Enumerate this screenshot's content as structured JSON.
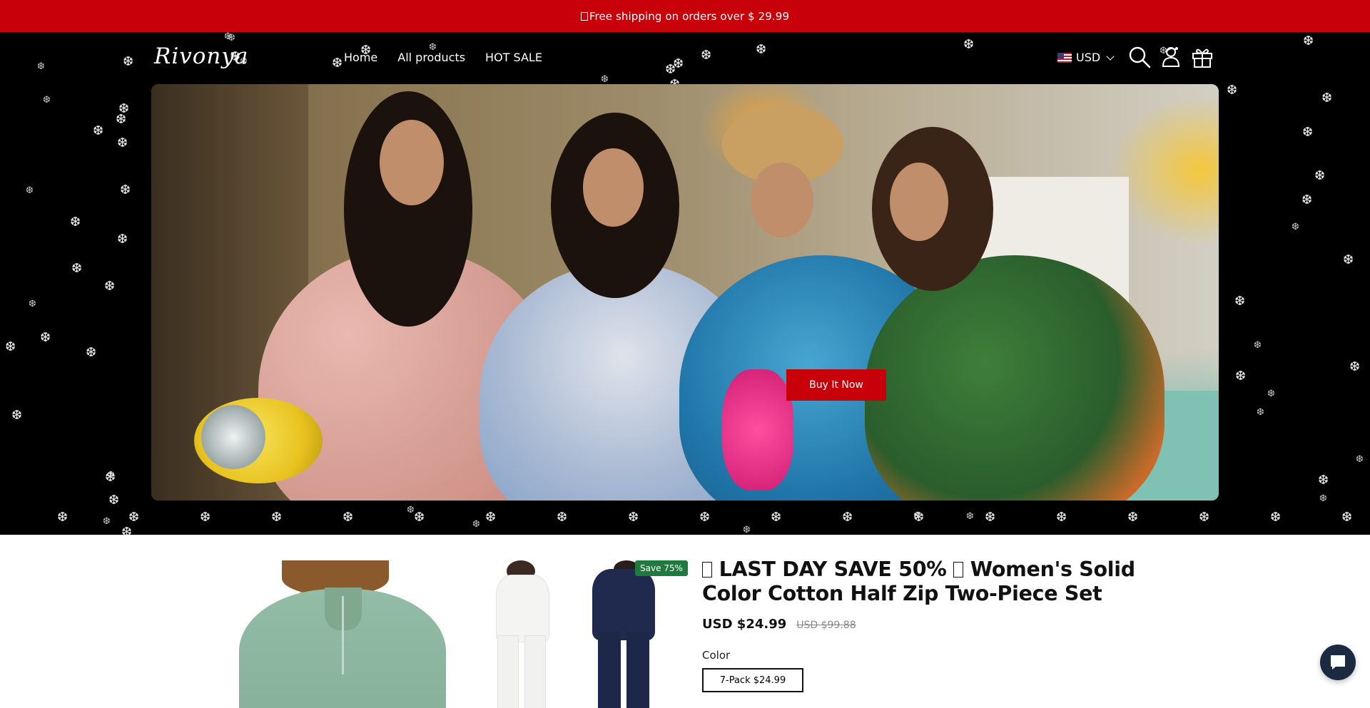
{
  "announcement": {
    "text": "Free shipping on orders over $ 29.99"
  },
  "header": {
    "logo": "Rivonya",
    "nav": [
      "Home",
      "All products",
      "HOT SALE"
    ],
    "currency": "USD",
    "icons": [
      "search-icon",
      "account-icon",
      "gift-icon"
    ]
  },
  "hero": {
    "button_label": "Buy It Now"
  },
  "product": {
    "badge": "Save 75%",
    "title": "LAST DAY SAVE 50%  Women's Solid Color Cotton Half Zip Two-Piece Set",
    "title_main": "LAST DAY SAVE 50%",
    "title_rest": "Women's Solid Color Cotton Half Zip Two-Piece Set",
    "price": "USD $24.99",
    "compare_price": "USD $99.88",
    "option_label": "Color",
    "selected_variant": "7-Pack $24.99"
  },
  "colors": {
    "accent_red": "#c8000a",
    "header_bg": "#000000",
    "badge_green": "#1f7a3d",
    "chat_bg": "#1b2a40"
  }
}
